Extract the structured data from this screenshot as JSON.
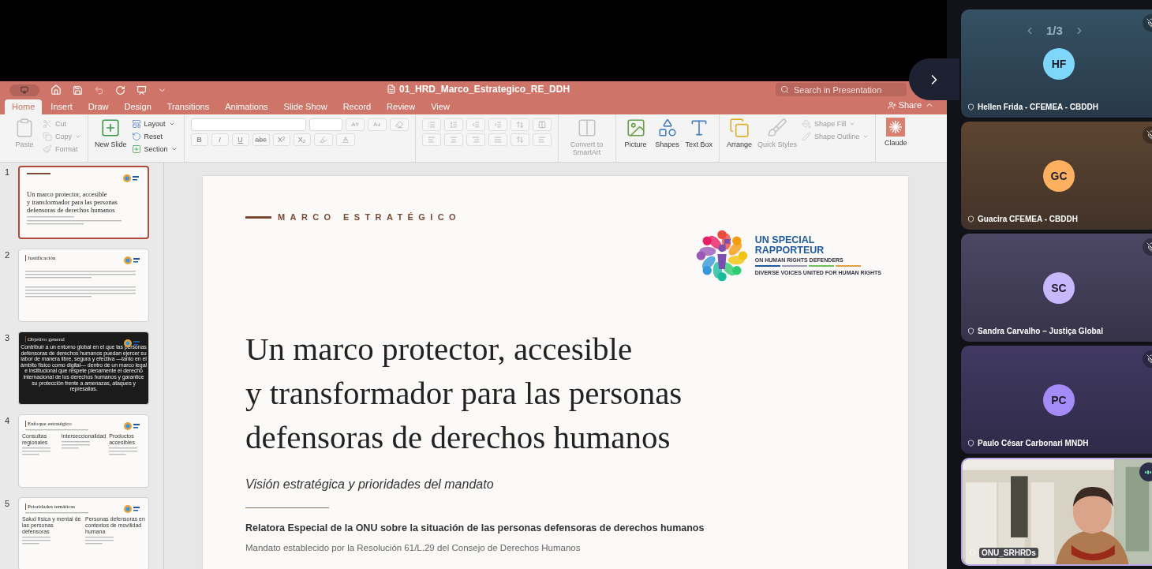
{
  "window": {
    "file_name": "01_HRD_Marco_Estrategico_RE_DDH",
    "search": {
      "placeholder": "Search in Presentation"
    },
    "share": "Share"
  },
  "tabs": [
    {
      "label": "Home",
      "selected": true
    },
    {
      "label": "Insert",
      "selected": false
    },
    {
      "label": "Draw",
      "selected": false
    },
    {
      "label": "Design",
      "selected": false
    },
    {
      "label": "Transitions",
      "selected": false
    },
    {
      "label": "Animations",
      "selected": false
    },
    {
      "label": "Slide Show",
      "selected": false
    },
    {
      "label": "Record",
      "selected": false
    },
    {
      "label": "Review",
      "selected": false
    },
    {
      "label": "View",
      "selected": false
    }
  ],
  "ribbon": [
    {
      "kind": "commands",
      "large": [
        {
          "kind": "paste",
          "label": "Paste",
          "disabled": true
        }
      ],
      "small": [
        {
          "kind": "cut",
          "label": "Cut",
          "disabled": true
        },
        {
          "kind": "copy",
          "label": "Copy",
          "disabled": true
        },
        {
          "kind": "format",
          "label": "Format",
          "disabled": true
        }
      ]
    },
    {
      "kind": "commands",
      "large": [
        {
          "kind": "new-slide",
          "label": "New Slide",
          "disabled": false
        }
      ],
      "small": [
        {
          "kind": "layout",
          "label": "Layout",
          "disabled": false
        },
        {
          "kind": "reset",
          "label": "Reset",
          "disabled": false
        },
        {
          "kind": "section",
          "label": "Section",
          "disabled": false
        }
      ]
    },
    {
      "kind": "font",
      "buttons": [
        "B",
        "I",
        "U",
        "abc",
        "X²",
        "X₂"
      ]
    },
    {
      "kind": "paragraph"
    },
    {
      "kind": "commands",
      "large": [
        {
          "kind": "smartart",
          "label": "Convert to SmartArt",
          "disabled": true
        }
      ]
    },
    {
      "kind": "commands",
      "large": [
        {
          "kind": "picture",
          "label": "Picture",
          "disabled": false
        },
        {
          "kind": "shapes",
          "label": "Shapes",
          "disabled": false
        },
        {
          "kind": "textbox",
          "label": "Text Box",
          "disabled": false
        }
      ]
    },
    {
      "kind": "commands",
      "large": [
        {
          "kind": "arrange",
          "label": "Arrange",
          "disabled": false
        },
        {
          "kind": "quickstyles",
          "label": "Quick Styles",
          "disabled": true
        }
      ],
      "small": [
        {
          "kind": "shapefill",
          "label": "Shape Fill",
          "disabled": true
        },
        {
          "kind": "shapeoutline",
          "label": "Shape Outline",
          "disabled": true
        }
      ]
    },
    {
      "kind": "commands",
      "large": [
        {
          "kind": "claude",
          "label": "Claude",
          "disabled": false
        }
      ]
    }
  ],
  "slides": [
    {
      "number": "1",
      "selected": true,
      "kind": "cover",
      "title_lines": [
        "Un marco protector, accesible",
        "y transformador para las personas",
        "defensoras de derechos humanos"
      ]
    },
    {
      "number": "2",
      "selected": false,
      "kind": "text",
      "title": "Justificación"
    },
    {
      "number": "3",
      "selected": false,
      "kind": "statement",
      "title": "Objetivo general",
      "body": "Contribuir a un entorno global en el que las personas defensoras de derechos humanos puedan ejercer su labor de manera libre, segura y efectiva —tanto en el ámbito físico como digital— dentro de un marco legal e institucional que respete plenamente el derecho internacional de los derechos humanos y garantice su protección frente a amenazas, ataques y represalias."
    },
    {
      "number": "4",
      "selected": false,
      "kind": "columns",
      "title": "Enfoque estratégico",
      "columns": [
        "Consultas regionales",
        "Interseccionalidad",
        "Productos accesibles"
      ]
    },
    {
      "number": "5",
      "selected": false,
      "kind": "columns",
      "title": "Prioridades temáticas",
      "columns": [
        "Salud física y mental de las personas defensoras",
        "Personas defensoras en contextos de movilidad humana"
      ]
    }
  ],
  "current_slide": {
    "kicker": "MARCO ESTRATÉGICO",
    "logo": {
      "title_lines": [
        "UN SPECIAL",
        "RAPPORTEUR"
      ],
      "subtitle": "ON HUMAN RIGHTS DEFENDERS",
      "tagline": "DIVERSE VOICES UNITED FOR HUMAN RIGHTS"
    },
    "title_lines": [
      "Un marco protector, accesible",
      "y transformador para las personas",
      "defensoras de derechos humanos"
    ],
    "subtitle": "Visión estratégica y prioridades del mandato",
    "author": "Relatora Especial de la ONU sobre la situación de las personas defensoras de derechos humanos",
    "mandate": "Mandato establecido por la Resolución 61/L.29 del Consejo de Derechos Humanos"
  },
  "participants": {
    "page": "1/3",
    "tiles": [
      {
        "kind": "avatar",
        "initials": "HF",
        "name": "Hellen Frida - CFEMEA - CBDDH",
        "color": "#7fd6fb",
        "muted": true
      },
      {
        "kind": "avatar",
        "initials": "GC",
        "name": "Guacira CFEMEA - CBDDH",
        "color": "#fdb05f",
        "muted": true
      },
      {
        "kind": "avatar",
        "initials": "SC",
        "name": "Sandra Carvalho – Justiça Global",
        "color": "#c7b7fd",
        "muted": true
      },
      {
        "kind": "avatar",
        "initials": "PC",
        "name": "Paulo César Carbonari MNDH",
        "color": "#a58bf8",
        "muted": true
      },
      {
        "kind": "video",
        "name": "ONU_SRHRDs",
        "muted": false
      }
    ]
  }
}
